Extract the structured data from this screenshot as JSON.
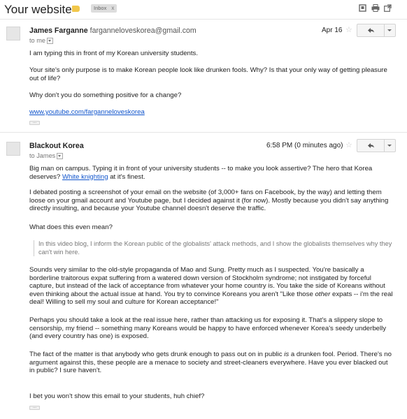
{
  "thread": {
    "subject": "Your website",
    "label_chip": "Inbox",
    "label_close": "x",
    "label_color": "#f1c74b"
  },
  "messages": [
    {
      "sender_name": "James Farganne",
      "sender_email": "farganneloveskorea@gmail.com",
      "to": "to me",
      "date": "Apr 16",
      "paragraphs": [
        "I am typing this in front of my Korean university students.",
        "Your site's only purpose is to make Korean people look like drunken fools. Why? Is that your only way of getting pleasure out of life?",
        "Why don't you do something positive for a change?"
      ],
      "link": "www.youtube.com/farganneloveskorea"
    },
    {
      "sender_name": "Blackout Korea",
      "to": "to James",
      "date": "6:58 PM (0 minutes ago)",
      "p1_text": "Big man on campus. Typing it in front of your university students -- to make you look assertive? The hero that Korea deserves? ",
      "p1_link": "White knighting",
      "p1_tail": " at it's finest.",
      "p2": "I debated posting a screenshot of your email on the website (of 3,000+ fans on Facebook, by the way) and letting them loose on your gmail account and Youtube page, but I decided against it (for now). Mostly because you didn't say anything directly insulting, and because your Youtube channel doesn't deserve the traffic.",
      "p3": "What does this even mean?",
      "quote": "In this video blog, I inform the Korean public of the globalists' attack methods, and I show the globalists themselves why they can't win here.",
      "p4_text": "Sounds very similar to the old-style propaganda of Mao and Sung. Pretty much as I suspected. You're basically a borderline traitorous expat suffering from a watered down version of Stockholm syndrome; not instigated by forceful capture, but instead of the lack of acceptance from whatever your home country is. You take the side of Koreans without even thinking about the actual issue at hand. You try to convince Koreans you aren't \"Like those ",
      "p4_em": "other",
      "p4_tail": " expats -- i'm the real deal! Willing to sell my soul and culture for Korean acceptance!\"",
      "p5": "Perhaps you should take a look at the real issue here, rather than attacking us for exposing it. That's a slippery slope to censorship, my friend -- something many Koreans would be happy to have enforced whenever Korea's seedy underbelly (and every country has one) is exposed.",
      "p6_text": "The fact of the matter is that anybody who gets drunk enough to pass out on in public ",
      "p6_em": "is",
      "p6_tail": " a drunken fool. Period. There's no argument against this, these people are a menace to society and street-cleaners everywhere. Have you ever blacked out in public? I sure haven't.",
      "p7": "I bet you won't show this email to your students, huh chief?"
    }
  ],
  "icons": [
    "print-all-icon",
    "print-icon",
    "new-window-icon",
    "star-icon",
    "reply-icon",
    "more-options-icon",
    "show-details-icon",
    "trimmed-content-icon"
  ]
}
